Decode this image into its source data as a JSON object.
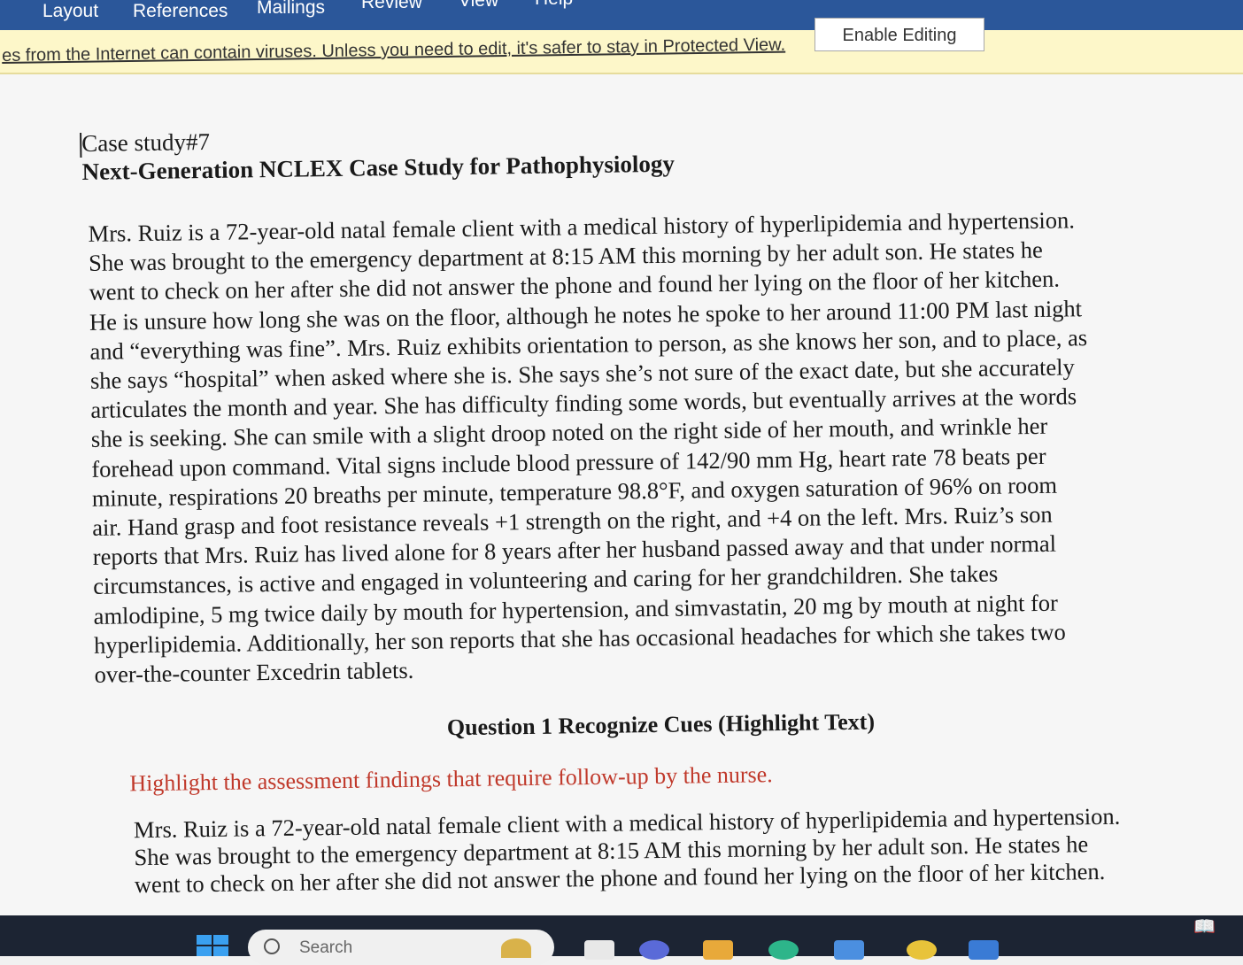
{
  "ribbon": {
    "tabs": [
      "Layout",
      "References",
      "Mailings",
      "Review",
      "View",
      "Help"
    ]
  },
  "protected_view": {
    "message": "es from the Internet can contain viruses. Unless you need to edit, it's safer to stay in Protected View.",
    "enable_button": "Enable Editing"
  },
  "document": {
    "title1": "Case study#7",
    "title2": "Next-Generation NCLEX Case Study for Pathophysiology",
    "paragraph_lines": [
      "Mrs. Ruiz is a 72-year-old natal female client with a medical history of hyperlipidemia and hypertension.",
      "She was brought to the emergency department at 8:15 AM this morning by her adult son. He states he",
      "went to check on her after she did not answer the phone and found her lying on the floor of her kitchen.",
      "He is unsure how long she was on the floor, although he notes he spoke to her around 11:00 PM last night",
      "and “everything was fine”. Mrs. Ruiz exhibits orientation to person, as she knows her son, and to place, as",
      "she says “hospital” when asked where she is. She says she’s not sure of the exact date, but she accurately",
      "articulates the month and year. She has difficulty finding some words, but eventually arrives at the words",
      "she is seeking. She can smile with a slight droop noted on the right side of her mouth, and wrinkle her",
      "forehead upon command. Vital signs include blood pressure of 142/90 mm Hg, heart rate 78 beats per",
      "minute, respirations 20 breaths per minute, temperature 98.8°F, and oxygen saturation of 96% on room",
      "air. Hand grasp and foot resistance reveals +1 strength on the right, and +4 on the left. Mrs. Ruiz’s son",
      "reports that Mrs. Ruiz has lived alone for 8 years after her husband passed away and that under normal",
      "circumstances, is active and engaged in volunteering and caring for her grandchildren. She takes",
      "amlodipine, 5 mg twice daily by mouth for hypertension, and simvastatin, 20 mg by mouth at night for",
      "hyperlipidemia. Additionally, her son reports that she has occasional headaches for which she takes two",
      "over-the-counter Excedrin tablets."
    ],
    "question_heading": "Question 1 Recognize Cues (Highlight Text)",
    "instruction": "Highlight the assessment findings that require follow-up by the nurse.",
    "paragraph2_lines": [
      "Mrs. Ruiz is a 72-year-old natal female client with a medical history of hyperlipidemia and hypertension.",
      "She was brought to the emergency department at 8:15 AM this morning by her adult son. He states he",
      "went to check on her after she did not answer the phone and found her lying on the floor of her kitchen."
    ]
  },
  "taskbar": {
    "search_label": "Search"
  },
  "colors": {
    "ribbon": "#2b579a",
    "protected_bar": "#fdf7c9",
    "instruction_text": "#c0392b"
  }
}
